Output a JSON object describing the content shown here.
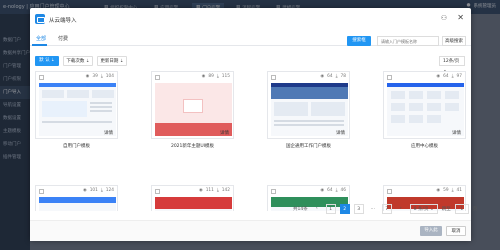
{
  "app": {
    "title": "e-nology | 应用门户管理中心"
  },
  "top_tabs": [
    {
      "label": "组织权限中心"
    },
    {
      "label": "应用引擎"
    },
    {
      "label": "门户引擎"
    },
    {
      "label": "流程引擎"
    },
    {
      "label": "建模引擎"
    }
  ],
  "user": {
    "name": "系统管理员"
  },
  "sidebar": {
    "items": [
      "数据门户",
      "数据共享门户",
      "门户管理",
      "门户权限",
      "门户导入",
      "导航设置",
      "数据设置",
      "主题模板",
      "移动门户",
      "插件管理"
    ]
  },
  "modal": {
    "title": "从云端导入",
    "tabs": [
      "全部",
      "付费"
    ],
    "search_button": "搜索框",
    "search_placeholder": "请输入门户模板名称",
    "advanced_button": "高级搜索",
    "sort_buttons": [
      "默 认",
      "下载次数",
      "更新日期"
    ],
    "page_size": "12条/页",
    "detail_label": "详情",
    "cards": [
      {
        "name": "自用门户模板",
        "views": "39",
        "downloads": "104"
      },
      {
        "name": "2021新年主题UI模板",
        "views": "89",
        "downloads": "115"
      },
      {
        "name": "国企通用工作门户模板",
        "views": "64",
        "downloads": "78"
      },
      {
        "name": "应用中心模板",
        "views": "64",
        "downloads": "97"
      },
      {
        "name": "",
        "views": "101",
        "downloads": "124"
      },
      {
        "name": "",
        "views": "111",
        "downloads": "142"
      },
      {
        "name": "",
        "views": "64",
        "downloads": "46"
      },
      {
        "name": "",
        "views": "59",
        "downloads": "41"
      }
    ],
    "pagination": {
      "total": "共14条",
      "pages": [
        "1",
        "2",
        "3",
        "7"
      ],
      "current": "2",
      "prev": "‹",
      "next": "›",
      "ellipsis": "...",
      "page_size": "8 条/页",
      "jump_label": "跳至",
      "jump_value": "1",
      "page_unit": "页"
    },
    "import_button": "导入此",
    "cancel_button": "取消"
  }
}
